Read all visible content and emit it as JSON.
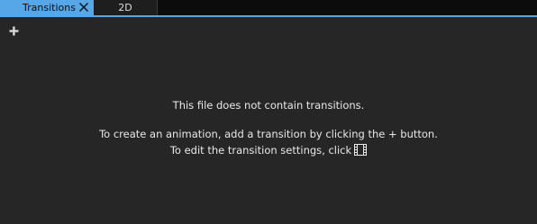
{
  "tabs": [
    {
      "label": "Transitions",
      "active": true
    },
    {
      "label": "2D",
      "active": false
    }
  ],
  "colors": {
    "accent": "#56a7e8",
    "background": "#262626",
    "tabbar": "#0c0c0c",
    "text": "#e8e8e8"
  },
  "toolbar": {
    "add_icon": "plus-icon"
  },
  "message": {
    "line1": "This file does not contain transitions.",
    "line2": "To create an animation, add a transition by clicking the + button.",
    "line3": "To edit the transition settings, click",
    "line3_icon": "film-icon"
  }
}
